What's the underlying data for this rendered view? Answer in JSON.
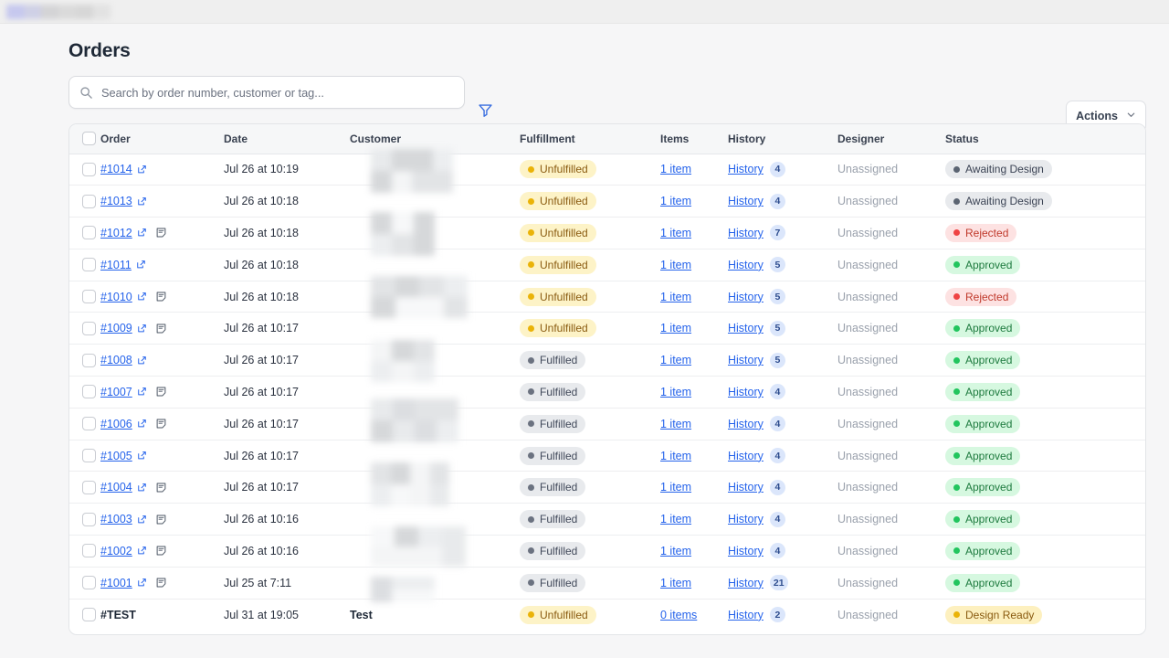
{
  "window": {
    "brand_redacted": true
  },
  "header": {
    "title": "Orders"
  },
  "search": {
    "placeholder": "Search by order number, customer or tag...",
    "value": "",
    "icon": "search-icon"
  },
  "filter": {
    "icon": "filter-funnel-icon",
    "color": "#3b6fe0"
  },
  "actions": {
    "label": "Actions",
    "caret_icon": "chevron-down-icon"
  },
  "table": {
    "columns": [
      "Order",
      "Date",
      "Customer",
      "Fulfillment",
      "Items",
      "History",
      "Designer",
      "Status"
    ],
    "rows": [
      {
        "order": "#1014",
        "link": true,
        "has_note": false,
        "date": "Jul 26 at 10:19",
        "customer": "",
        "customer_redacted": true,
        "fulfillment": "Unfulfilled",
        "fulfillment_style": "unfulfilled",
        "items": "1 item",
        "history": "History",
        "history_count": "4",
        "designer": "Unassigned",
        "status": "Awaiting Design",
        "status_style": "awaiting"
      },
      {
        "order": "#1013",
        "link": true,
        "has_note": false,
        "date": "Jul 26 at 10:18",
        "customer": "",
        "customer_redacted": true,
        "fulfillment": "Unfulfilled",
        "fulfillment_style": "unfulfilled",
        "items": "1 item",
        "history": "History",
        "history_count": "4",
        "designer": "Unassigned",
        "status": "Awaiting Design",
        "status_style": "awaiting"
      },
      {
        "order": "#1012",
        "link": true,
        "has_note": true,
        "date": "Jul 26 at 10:18",
        "customer": "",
        "customer_redacted": true,
        "fulfillment": "Unfulfilled",
        "fulfillment_style": "unfulfilled",
        "items": "1 item",
        "history": "History",
        "history_count": "7",
        "designer": "Unassigned",
        "status": "Rejected",
        "status_style": "rejected"
      },
      {
        "order": "#1011",
        "link": true,
        "has_note": false,
        "date": "Jul 26 at 10:18",
        "customer": "",
        "customer_redacted": true,
        "fulfillment": "Unfulfilled",
        "fulfillment_style": "unfulfilled",
        "items": "1 item",
        "history": "History",
        "history_count": "5",
        "designer": "Unassigned",
        "status": "Approved",
        "status_style": "approved"
      },
      {
        "order": "#1010",
        "link": true,
        "has_note": true,
        "date": "Jul 26 at 10:18",
        "customer": "",
        "customer_redacted": true,
        "fulfillment": "Unfulfilled",
        "fulfillment_style": "unfulfilled",
        "items": "1 item",
        "history": "History",
        "history_count": "5",
        "designer": "Unassigned",
        "status": "Rejected",
        "status_style": "rejected"
      },
      {
        "order": "#1009",
        "link": true,
        "has_note": true,
        "date": "Jul 26 at 10:17",
        "customer": "",
        "customer_redacted": true,
        "fulfillment": "Unfulfilled",
        "fulfillment_style": "unfulfilled",
        "items": "1 item",
        "history": "History",
        "history_count": "5",
        "designer": "Unassigned",
        "status": "Approved",
        "status_style": "approved"
      },
      {
        "order": "#1008",
        "link": true,
        "has_note": false,
        "date": "Jul 26 at 10:17",
        "customer": "",
        "customer_redacted": true,
        "fulfillment": "Fulfilled",
        "fulfillment_style": "fulfilled",
        "items": "1 item",
        "history": "History",
        "history_count": "5",
        "designer": "Unassigned",
        "status": "Approved",
        "status_style": "approved"
      },
      {
        "order": "#1007",
        "link": true,
        "has_note": true,
        "date": "Jul 26 at 10:17",
        "customer": "",
        "customer_redacted": true,
        "fulfillment": "Fulfilled",
        "fulfillment_style": "fulfilled",
        "items": "1 item",
        "history": "History",
        "history_count": "4",
        "designer": "Unassigned",
        "status": "Approved",
        "status_style": "approved"
      },
      {
        "order": "#1006",
        "link": true,
        "has_note": true,
        "date": "Jul 26 at 10:17",
        "customer": "",
        "customer_redacted": true,
        "fulfillment": "Fulfilled",
        "fulfillment_style": "fulfilled",
        "items": "1 item",
        "history": "History",
        "history_count": "4",
        "designer": "Unassigned",
        "status": "Approved",
        "status_style": "approved"
      },
      {
        "order": "#1005",
        "link": true,
        "has_note": false,
        "date": "Jul 26 at 10:17",
        "customer": "",
        "customer_redacted": true,
        "fulfillment": "Fulfilled",
        "fulfillment_style": "fulfilled",
        "items": "1 item",
        "history": "History",
        "history_count": "4",
        "designer": "Unassigned",
        "status": "Approved",
        "status_style": "approved"
      },
      {
        "order": "#1004",
        "link": true,
        "has_note": true,
        "date": "Jul 26 at 10:17",
        "customer": "",
        "customer_redacted": true,
        "fulfillment": "Fulfilled",
        "fulfillment_style": "fulfilled",
        "items": "1 item",
        "history": "History",
        "history_count": "4",
        "designer": "Unassigned",
        "status": "Approved",
        "status_style": "approved"
      },
      {
        "order": "#1003",
        "link": true,
        "has_note": true,
        "date": "Jul 26 at 10:16",
        "customer": "",
        "customer_redacted": true,
        "fulfillment": "Fulfilled",
        "fulfillment_style": "fulfilled",
        "items": "1 item",
        "history": "History",
        "history_count": "4",
        "designer": "Unassigned",
        "status": "Approved",
        "status_style": "approved"
      },
      {
        "order": "#1002",
        "link": true,
        "has_note": true,
        "date": "Jul 26 at 10:16",
        "customer": "",
        "customer_redacted": true,
        "fulfillment": "Fulfilled",
        "fulfillment_style": "fulfilled",
        "items": "1 item",
        "history": "History",
        "history_count": "4",
        "designer": "Unassigned",
        "status": "Approved",
        "status_style": "approved"
      },
      {
        "order": "#1001",
        "link": true,
        "has_note": true,
        "date": "Jul 25 at 7:11",
        "customer": "",
        "customer_redacted": true,
        "fulfillment": "Fulfilled",
        "fulfillment_style": "fulfilled",
        "items": "1 item",
        "history": "History",
        "history_count": "21",
        "designer": "Unassigned",
        "status": "Approved",
        "status_style": "approved"
      },
      {
        "order": "#TEST",
        "link": false,
        "has_note": false,
        "date": "Jul 31 at 19:05",
        "customer": "Test",
        "customer_redacted": false,
        "fulfillment": "Unfulfilled",
        "fulfillment_style": "unfulfilled",
        "items": "0 items",
        "history": "History",
        "history_count": "2",
        "designer": "Unassigned",
        "status": "Design Ready",
        "status_style": "designready"
      }
    ]
  },
  "colors": {
    "link": "#2563eb",
    "accent": "#3b6fe0",
    "page_bg": "#f6f6f7",
    "card_bg": "#ffffff",
    "header_bg": "#f6f7f8"
  }
}
